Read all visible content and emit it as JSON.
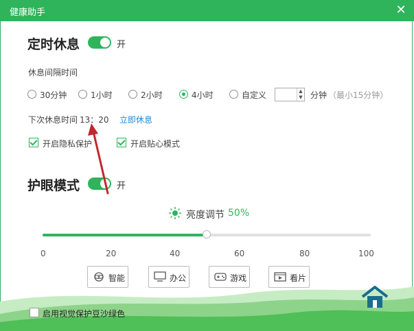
{
  "window": {
    "title": "健康助手",
    "close_glyph": "✕"
  },
  "rest": {
    "heading": "定时休息",
    "toggle_label": "开",
    "interval_label": "休息间隔时间",
    "options": [
      "30分钟",
      "1小时",
      "2小时",
      "4小时",
      "自定义"
    ],
    "selected": "4小时",
    "custom_unit": "分钟",
    "custom_hint": "（最小15分钟）",
    "next_label": "下次休息时间",
    "next_time": "13：20",
    "rest_now": "立即休息",
    "privacy": "开启隐私保护",
    "caring": "开启贴心模式"
  },
  "eye": {
    "heading": "护眼模式",
    "toggle_label": "开",
    "brightness_label": "亮度调节",
    "brightness_value": "50%",
    "brightness_level": 50,
    "ticks": [
      "0",
      "20",
      "40",
      "60",
      "80",
      "100"
    ],
    "modes": [
      {
        "label": "智能",
        "icon": "brain-icon"
      },
      {
        "label": "办公",
        "icon": "monitor-icon"
      },
      {
        "label": "游戏",
        "icon": "gamepad-icon"
      },
      {
        "label": "看片",
        "icon": "film-icon"
      }
    ],
    "bean_green": "启用视觉保护豆沙绿色"
  },
  "colors": {
    "accent": "#2fb45b",
    "link": "#1e88d8",
    "annotation": "#c0282d"
  }
}
